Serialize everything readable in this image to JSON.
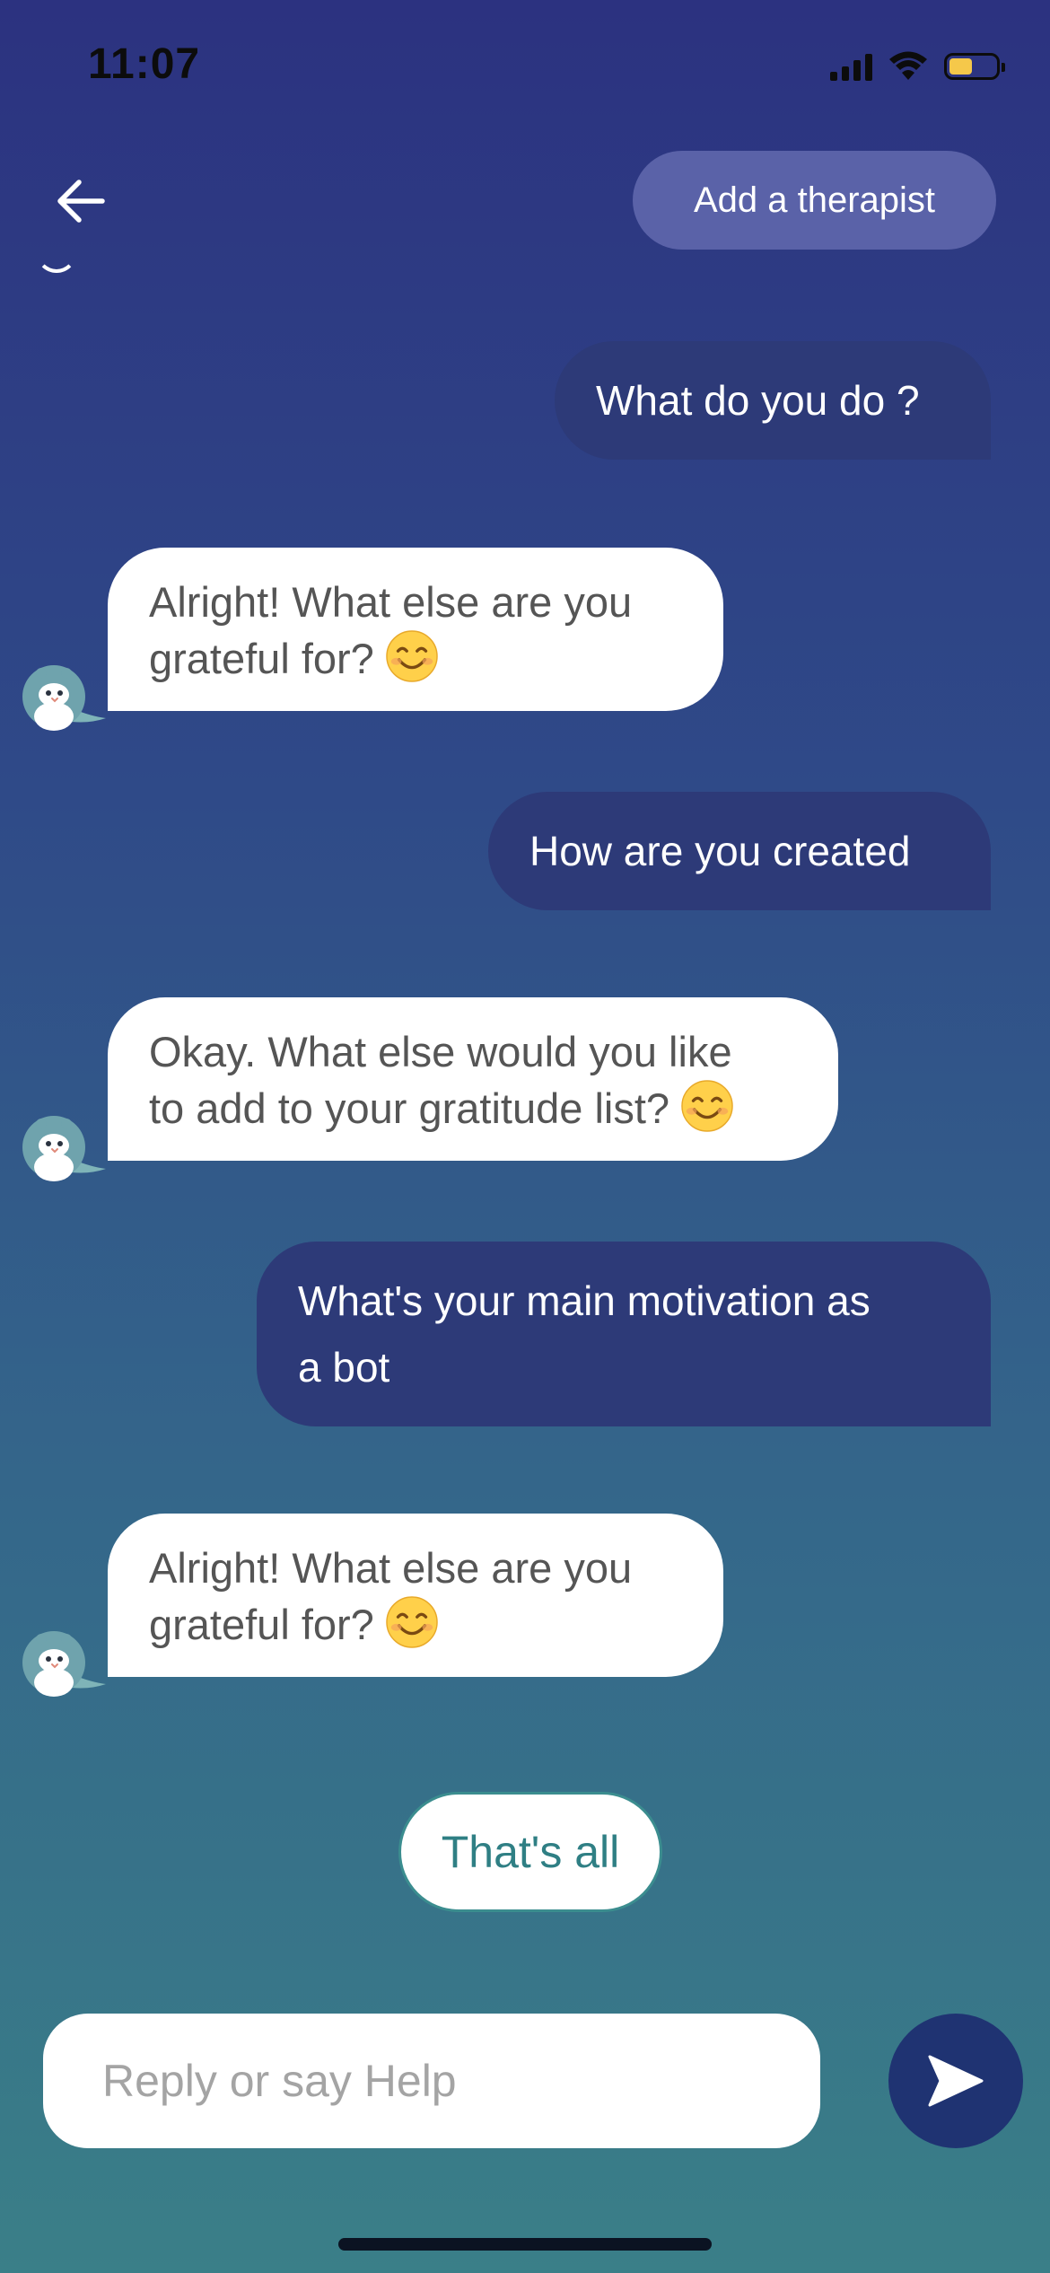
{
  "status_bar": {
    "time": "11:07",
    "icons": [
      "signal-icon",
      "wifi-icon",
      "battery-icon"
    ],
    "battery_level": 0.5,
    "battery_color": "#f5c84a"
  },
  "header": {
    "back_icon": "arrow-left-icon",
    "therapist_button_label": "Add a therapist"
  },
  "messages": [
    {
      "sender": "user",
      "text": "What do you do ?"
    },
    {
      "sender": "bot",
      "line1": "Alright! What else are you",
      "line2": "grateful for?",
      "emoji": "smiling-face-icon"
    },
    {
      "sender": "user",
      "text": "How are you created"
    },
    {
      "sender": "bot",
      "line1": "Okay. What else would you like",
      "line2": "to add to your gratitude list?",
      "emoji": "smiling-face-icon"
    },
    {
      "sender": "user",
      "line1": "What's your main motivation as",
      "line2": "a bot"
    },
    {
      "sender": "bot",
      "line1": "Alright! What else are you",
      "line2": "grateful for?",
      "emoji": "smiling-face-icon"
    }
  ],
  "quick_reply": {
    "label": "That's all"
  },
  "composer": {
    "placeholder": "Reply or say Help",
    "value": "",
    "send_icon": "send-icon"
  },
  "colors": {
    "background_top": "#2c3280",
    "background_bottom": "#3a7f88",
    "user_bubble": "#2d3a78",
    "bot_bubble": "#ffffff",
    "therapist_button": "#5a62a8",
    "send_button": "#1f3372",
    "accent_teal": "#2f7f84"
  }
}
